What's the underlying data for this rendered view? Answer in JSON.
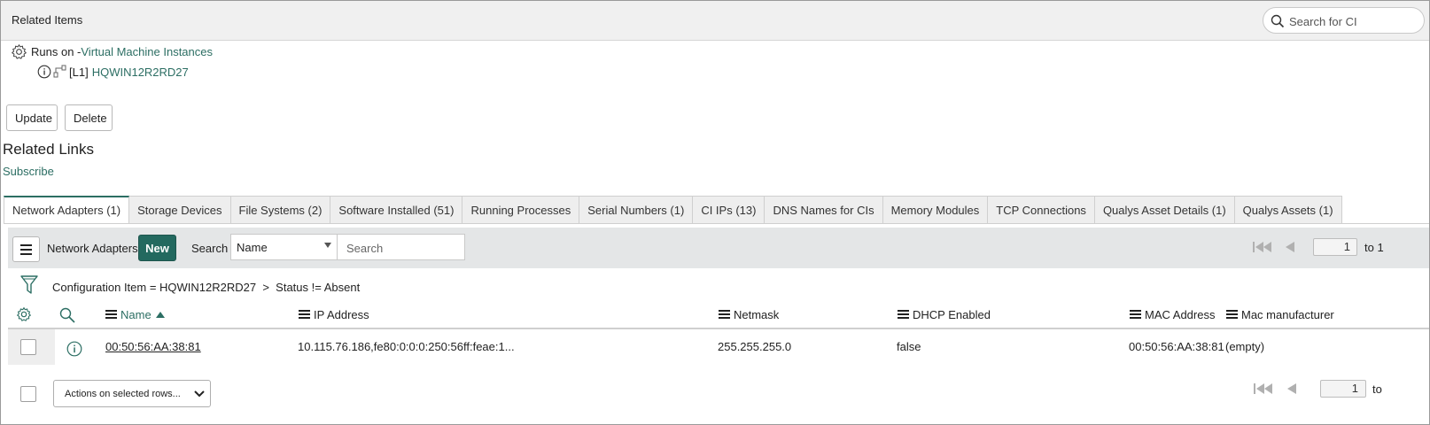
{
  "header": {
    "title": "Related Items",
    "search_placeholder": "Search for CI"
  },
  "tree": {
    "runs_on_label": "Runs on - ",
    "runs_on_link": "Virtual Machine Instances",
    "ci_level": "[L1]",
    "ci_name": "HQWIN12R2RD27"
  },
  "buttons": {
    "update": "Update",
    "delete": "Delete"
  },
  "related_links": {
    "title": "Related Links",
    "subscribe": "Subscribe"
  },
  "tabs": [
    {
      "label": "Network Adapters (1)",
      "active": true
    },
    {
      "label": "Storage Devices"
    },
    {
      "label": "File Systems (2)"
    },
    {
      "label": "Software Installed (51)"
    },
    {
      "label": "Running Processes"
    },
    {
      "label": "Serial Numbers (1)"
    },
    {
      "label": "CI IPs (13)"
    },
    {
      "label": "DNS Names for CIs"
    },
    {
      "label": "Memory Modules"
    },
    {
      "label": "TCP Connections"
    },
    {
      "label": "Qualys Asset Details (1)"
    },
    {
      "label": "Qualys Assets (1)"
    }
  ],
  "list": {
    "title": "Network Adapters",
    "new_label": "New",
    "search_label": "Search",
    "search_field": "Name",
    "search_placeholder": "Search",
    "page_value": "1",
    "page_to": "to 1",
    "filter_breadcrumb": "Configuration Item = HQWIN12R2RD27  >  Status != Absent",
    "columns": [
      "Name",
      "IP Address",
      "Netmask",
      "DHCP Enabled",
      "MAC Address",
      "Mac manufacturer"
    ],
    "rows": [
      {
        "name": "00:50:56:AA:38:81",
        "ip_address": "10.115.76.186,fe80:0:0:0:250:56ff:feae:1...",
        "netmask": "255.255.255.0",
        "dhcp_enabled": "false",
        "mac_address": "00:50:56:AA:38:81",
        "mac_manufacturer": "(empty)"
      }
    ]
  },
  "footer": {
    "actions_placeholder": "Actions on selected rows...",
    "page_value": "1",
    "page_to": "to"
  },
  "colors": {
    "accent": "#2c6e63",
    "new_button": "#23695f",
    "toolbar_bg": "#e4e6e7",
    "header_bg": "#f0f0f0"
  }
}
